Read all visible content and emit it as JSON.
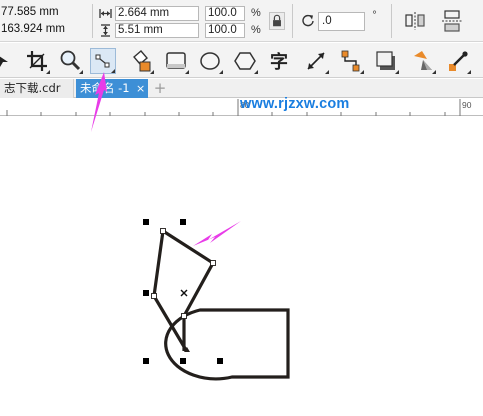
{
  "property_bar": {
    "x_position": "77.585 mm",
    "y_position": "163.924 mm",
    "width": "2.664 mm",
    "height": "5.51 mm",
    "scale_x": "100.0",
    "scale_y": "100.0",
    "percent_symbol": "%",
    "angle": ".0",
    "degree_symbol": "°"
  },
  "tabs": [
    {
      "label": "志下载.cdr",
      "active": false
    },
    {
      "label": "未命名 -1",
      "active": true
    }
  ],
  "tab_close": "×",
  "tab_add": "+",
  "ruler": {
    "labels": [
      "80",
      "90"
    ]
  },
  "watermark": "www.rjzxw.com",
  "colors": {
    "active_tab": "#3d8fd6",
    "annotation_arrow": "#e83ce8",
    "watermark": "#1a7ee0",
    "path_stroke": "#231f1c"
  },
  "icons": [
    "crop-icon",
    "zoom-icon",
    "shape-tool-icon",
    "smart-fill-icon",
    "rectangle-icon",
    "ellipse-icon",
    "polygon-icon",
    "text-icon",
    "dimension-icon",
    "connector-icon",
    "drop-shadow-icon",
    "transparency-icon",
    "eyedropper-icon",
    "lock-ratio-icon",
    "rotate-icon",
    "mirror-horizontal-icon",
    "mirror-vertical-icon"
  ]
}
